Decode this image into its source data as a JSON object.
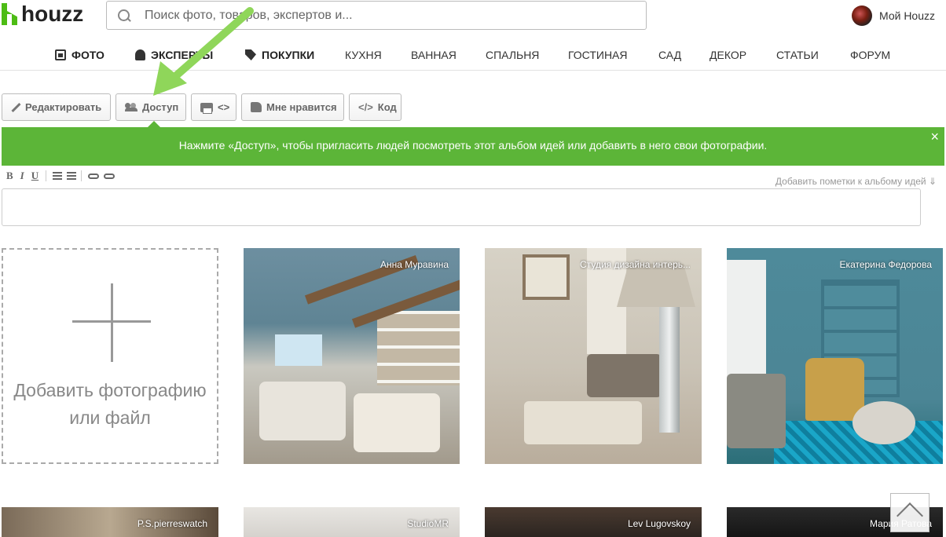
{
  "header": {
    "logo_text": "houzz",
    "search_placeholder": "Поиск фото, товаров, экспертов и...",
    "account_label": "Мой Houzz"
  },
  "nav": {
    "items": [
      {
        "label": "ФОТО",
        "icon": "photo-icon",
        "bold": true
      },
      {
        "label": "ЭКСПЕРТЫ",
        "icon": "professional-icon",
        "bold": true
      },
      {
        "label": "ПОКУПКИ",
        "icon": "tag-icon",
        "bold": true
      },
      {
        "label": "КУХНЯ"
      },
      {
        "label": "ВАННАЯ"
      },
      {
        "label": "СПАЛЬНЯ"
      },
      {
        "label": "ГОСТИНАЯ"
      },
      {
        "label": "САД"
      },
      {
        "label": "ДЕКОР"
      },
      {
        "label": "СТАТЬИ"
      },
      {
        "label": "ФОРУМ"
      }
    ]
  },
  "toolbar": {
    "edit_label": "Редактировать",
    "share_label": "Доступ",
    "print_label": "<>",
    "like_label": "Мне нравится",
    "code_label": "Код",
    "code_icon": "</>"
  },
  "banner": {
    "text": "Нажмите «Доступ», чтобы пригласить людей посмотреть этот альбом идей или добавить в него свои фотографии.",
    "close": "×"
  },
  "editor": {
    "bold": "B",
    "italic": "I",
    "underline": "U",
    "notes_hint": "Добавить пометки к альбому идей ⇓"
  },
  "add_tile": {
    "line1": "Добавить фотографию",
    "line2": "или файл"
  },
  "photos": [
    {
      "credit": "Анна Муравина"
    },
    {
      "credit": "Студия дизайна интерь..."
    },
    {
      "credit": "Екатерина Федорова"
    },
    {
      "credit": "P.S.pierreswatch"
    },
    {
      "credit": "StudioMR"
    },
    {
      "credit": "Lev Lugovskoy"
    },
    {
      "credit": "Мария Ратова"
    }
  ],
  "colors": {
    "brand_green": "#4dbc15",
    "banner_green": "#5cb538",
    "annotation_arrow": "#8fd65a"
  }
}
